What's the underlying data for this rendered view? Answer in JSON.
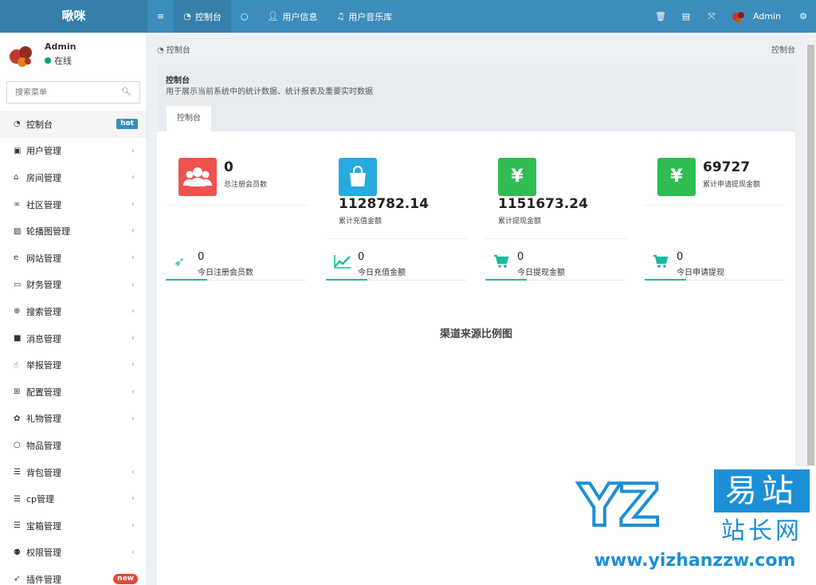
{
  "app": {
    "logo": "啾咪"
  },
  "header": {
    "menu_toggle_icon": "≡",
    "tabs": [
      {
        "label": "控制台",
        "icon": "dashboard-icon"
      },
      {
        "label": "",
        "icon": "circle-icon"
      },
      {
        "label": "用户信息",
        "icon": "user-icon"
      },
      {
        "label": "用户音乐库",
        "icon": "music-icon"
      }
    ],
    "user": "Admin"
  },
  "sidebar": {
    "user_name": "Admin",
    "status": "在线",
    "status_color": "#00a65a",
    "search_placeholder": "搜索菜单",
    "items": [
      {
        "label": "控制台",
        "icon": "dashboard-icon",
        "badge": "hot"
      },
      {
        "label": "用户管理",
        "icon": "user-icon"
      },
      {
        "label": "房间管理",
        "icon": "bank-icon"
      },
      {
        "label": "社区管理",
        "icon": "bicycle-icon"
      },
      {
        "label": "轮播图管理",
        "icon": "image-icon"
      },
      {
        "label": "网站管理",
        "icon": "ie-icon"
      },
      {
        "label": "财务管理",
        "icon": "money-icon"
      },
      {
        "label": "搜索管理",
        "icon": "search-icon"
      },
      {
        "label": "消息管理",
        "icon": "message-icon"
      },
      {
        "label": "举报管理",
        "icon": "hand-icon"
      },
      {
        "label": "配置管理",
        "icon": "sitemap-icon"
      },
      {
        "label": "礼物管理",
        "icon": "gift-icon"
      },
      {
        "label": "物品管理",
        "icon": "circle-icon"
      },
      {
        "label": "背包管理",
        "icon": "list-icon"
      },
      {
        "label": "cp管理",
        "icon": "list-icon"
      },
      {
        "label": "宝箱管理",
        "icon": "list-icon"
      },
      {
        "label": "权限管理",
        "icon": "group-icon"
      },
      {
        "label": "插件管理",
        "icon": "rocket-icon",
        "badge": "new"
      }
    ]
  },
  "breadcrumb": {
    "left": "控制台",
    "right": "控制台"
  },
  "panel": {
    "title": "控制台",
    "description": "用于展示当前系统中的统计数据、统计报表及重要实时数据",
    "tab": "控制台"
  },
  "stats": [
    {
      "value": "0",
      "label": "总注册会员数",
      "color": "#f0524f",
      "icon": "users-icon"
    },
    {
      "value": "1128782.14",
      "label": "累计充值金额",
      "color": "#27aae1",
      "icon": "shopping-bag-icon"
    },
    {
      "value": "1151673.24",
      "label": "累计提现金额",
      "color": "#2fbd53",
      "icon": "yen-icon"
    },
    {
      "value": "69727",
      "label": "累计申请提现金额",
      "color": "#2fbd53",
      "icon": "yen-icon"
    }
  ],
  "today": [
    {
      "value": "0",
      "label": "今日注册会员数",
      "icon": "rocket-icon"
    },
    {
      "value": "0",
      "label": "今日充值金额",
      "icon": "line-chart-icon"
    },
    {
      "value": "0",
      "label": "今日提现金额",
      "icon": "cart-icon"
    },
    {
      "value": "0",
      "label": "今日申请提现",
      "icon": "cart-icon"
    }
  ],
  "chart_title": "渠道来源比例图",
  "watermark": {
    "letters": "YZ",
    "cn_top": "易站",
    "cn_bottom": "站长网",
    "url": "www.yizhanzzw.com"
  }
}
